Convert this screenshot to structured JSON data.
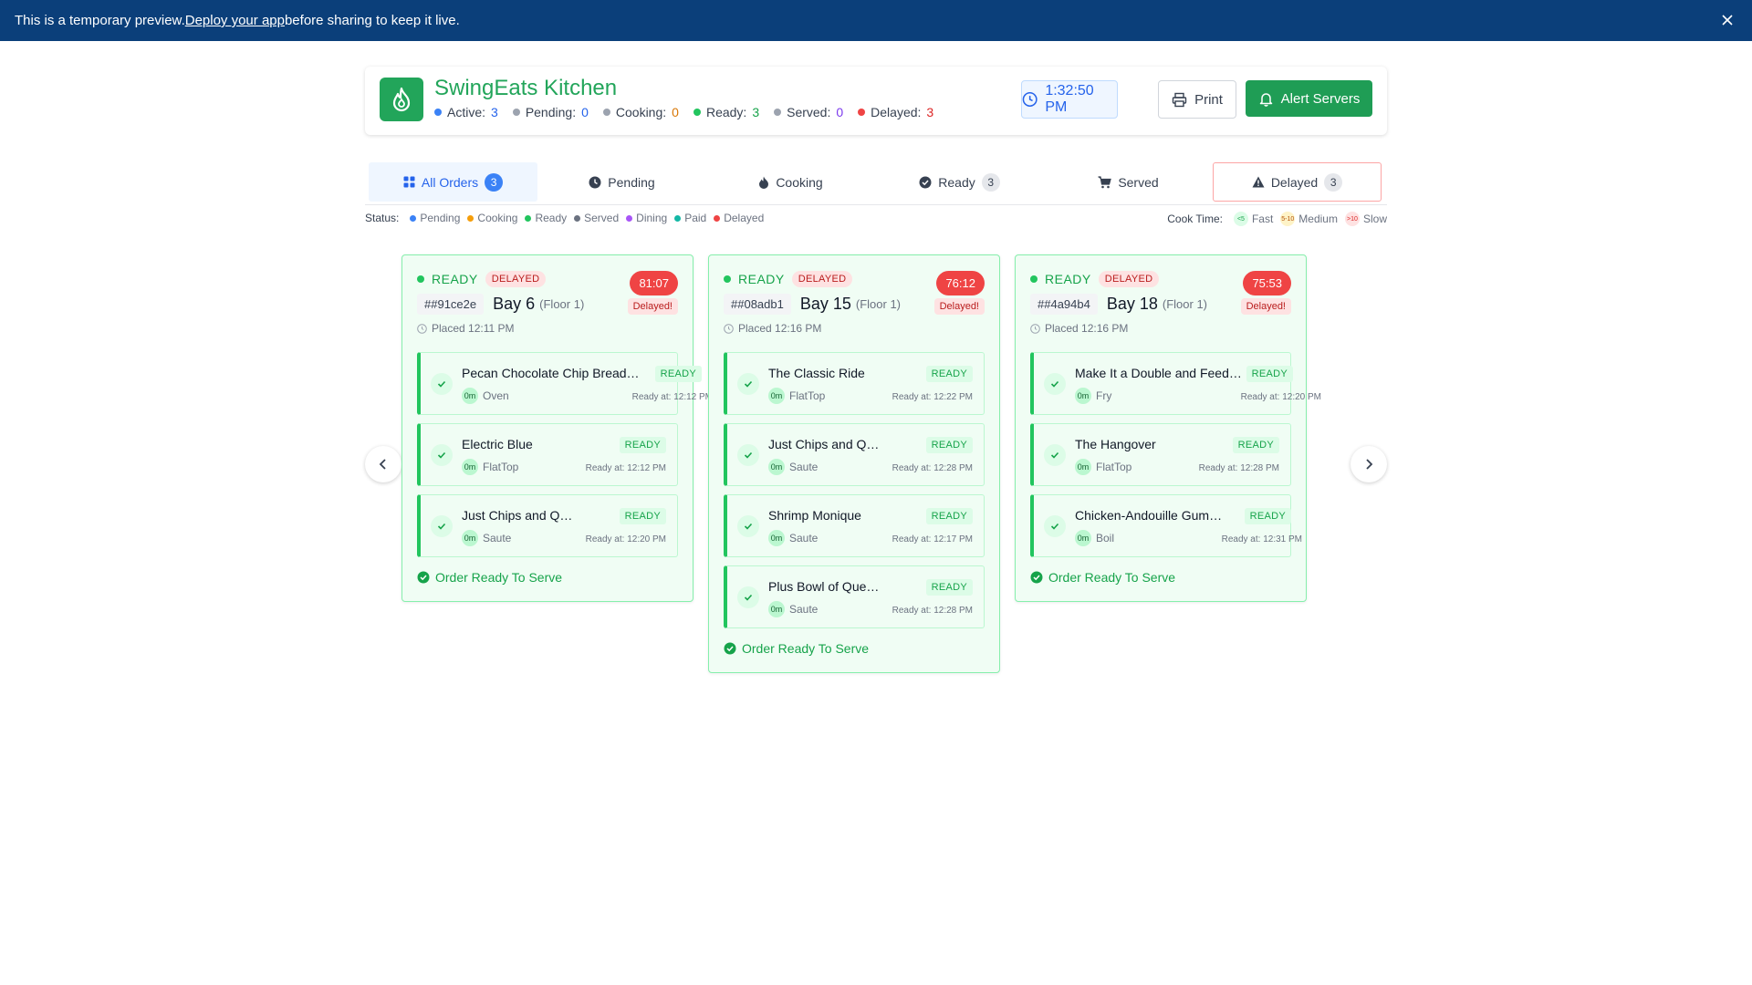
{
  "banner": {
    "text_before": "This is a temporary preview. ",
    "link": "Deploy your app",
    "text_after": " before sharing to keep it live."
  },
  "header": {
    "title": "SwingEats Kitchen",
    "stats": [
      {
        "label": "Active:",
        "value": "3",
        "color": "#3b82f6"
      },
      {
        "label": "Pending:",
        "value": "0",
        "color": "#9ca3af",
        "value_color": "#2563eb"
      },
      {
        "label": "Cooking:",
        "value": "0",
        "color": "#9ca3af",
        "value_color": "#d97706"
      },
      {
        "label": "Ready:",
        "value": "3",
        "color": "#22c55e",
        "value_color": "#16a34a"
      },
      {
        "label": "Served:",
        "value": "0",
        "color": "#9ca3af",
        "value_color": "#7c3aed"
      },
      {
        "label": "Delayed:",
        "value": "3",
        "color": "#ef4444",
        "value_color": "#dc2626"
      }
    ],
    "clock": "1:32:50 PM",
    "print_label": "Print",
    "alert_label": "Alert Servers"
  },
  "tabs": [
    {
      "label": "All Orders",
      "count": "3",
      "icon": "grid-icon"
    },
    {
      "label": "Pending",
      "count": "",
      "icon": "clock-icon"
    },
    {
      "label": "Cooking",
      "count": "",
      "icon": "flame-icon"
    },
    {
      "label": "Ready",
      "count": "3",
      "icon": "check-circle-icon"
    },
    {
      "label": "Served",
      "count": "",
      "icon": "cart-icon"
    },
    {
      "label": "Delayed",
      "count": "3",
      "icon": "warning-icon"
    }
  ],
  "legend": {
    "status_label": "Status:",
    "statuses": [
      {
        "label": "Pending",
        "color": "#3b82f6"
      },
      {
        "label": "Cooking",
        "color": "#f59e0b"
      },
      {
        "label": "Ready",
        "color": "#22c55e"
      },
      {
        "label": "Served",
        "color": "#6b7280"
      },
      {
        "label": "Dining",
        "color": "#a855f7"
      },
      {
        "label": "Paid",
        "color": "#14b8a6"
      },
      {
        "label": "Delayed",
        "color": "#ef4444"
      }
    ],
    "cook_label": "Cook Time:",
    "cook_times": [
      {
        "badge": "<5",
        "label": "Fast",
        "color": "#dcfce7",
        "text": "#16a34a"
      },
      {
        "badge": "5-10",
        "label": "Medium",
        "color": "#fef3c7",
        "text": "#b45309"
      },
      {
        "badge": ">10",
        "label": "Slow",
        "color": "#fee2e2",
        "text": "#dc2626"
      }
    ]
  },
  "orders": [
    {
      "status": "READY",
      "delayed_badge": "DELAYED",
      "timer": "81:07",
      "delayed_tag": "Delayed!",
      "id": "##91ce2e",
      "bay": "Bay 6",
      "floor": "(Floor 1)",
      "placed": "Placed 12:11 PM",
      "items": [
        {
          "name": "Pecan Chocolate Chip Bread…",
          "min": "0m",
          "station": "Oven",
          "status": "READY",
          "ready_at": "Ready at: 12:12 PM"
        },
        {
          "name": "Electric Blue",
          "min": "0m",
          "station": "FlatTop",
          "status": "READY",
          "ready_at": "Ready at: 12:12 PM"
        },
        {
          "name": "Just Chips and Q…",
          "min": "0m",
          "station": "Saute",
          "status": "READY",
          "ready_at": "Ready at: 12:20 PM"
        }
      ],
      "footer": "Order Ready To Serve"
    },
    {
      "status": "READY",
      "delayed_badge": "DELAYED",
      "timer": "76:12",
      "delayed_tag": "Delayed!",
      "id": "##08adb1",
      "bay": "Bay 15",
      "floor": "(Floor 1)",
      "placed": "Placed 12:16 PM",
      "items": [
        {
          "name": "The Classic Ride",
          "min": "0m",
          "station": "FlatTop",
          "status": "READY",
          "ready_at": "Ready at: 12:22 PM"
        },
        {
          "name": "Just Chips and Q…",
          "min": "0m",
          "station": "Saute",
          "status": "READY",
          "ready_at": "Ready at: 12:28 PM"
        },
        {
          "name": "Shrimp Monique",
          "min": "0m",
          "station": "Saute",
          "status": "READY",
          "ready_at": "Ready at: 12:17 PM"
        },
        {
          "name": "Plus Bowl of Que…",
          "min": "0m",
          "station": "Saute",
          "status": "READY",
          "ready_at": "Ready at: 12:28 PM"
        }
      ],
      "footer": "Order Ready To Serve"
    },
    {
      "status": "READY",
      "delayed_badge": "DELAYED",
      "timer": "75:53",
      "delayed_tag": "Delayed!",
      "id": "##4a94b4",
      "bay": "Bay 18",
      "floor": "(Floor 1)",
      "placed": "Placed 12:16 PM",
      "items": [
        {
          "name": "Make It a Double and Feed…",
          "min": "0m",
          "station": "Fry",
          "status": "READY",
          "ready_at": "Ready at: 12:20 PM"
        },
        {
          "name": "The Hangover",
          "min": "0m",
          "station": "FlatTop",
          "status": "READY",
          "ready_at": "Ready at: 12:28 PM"
        },
        {
          "name": "Chicken-Andouille Gum…",
          "min": "0m",
          "station": "Boil",
          "status": "READY",
          "ready_at": "Ready at: 12:31 PM"
        }
      ],
      "footer": "Order Ready To Serve"
    }
  ]
}
